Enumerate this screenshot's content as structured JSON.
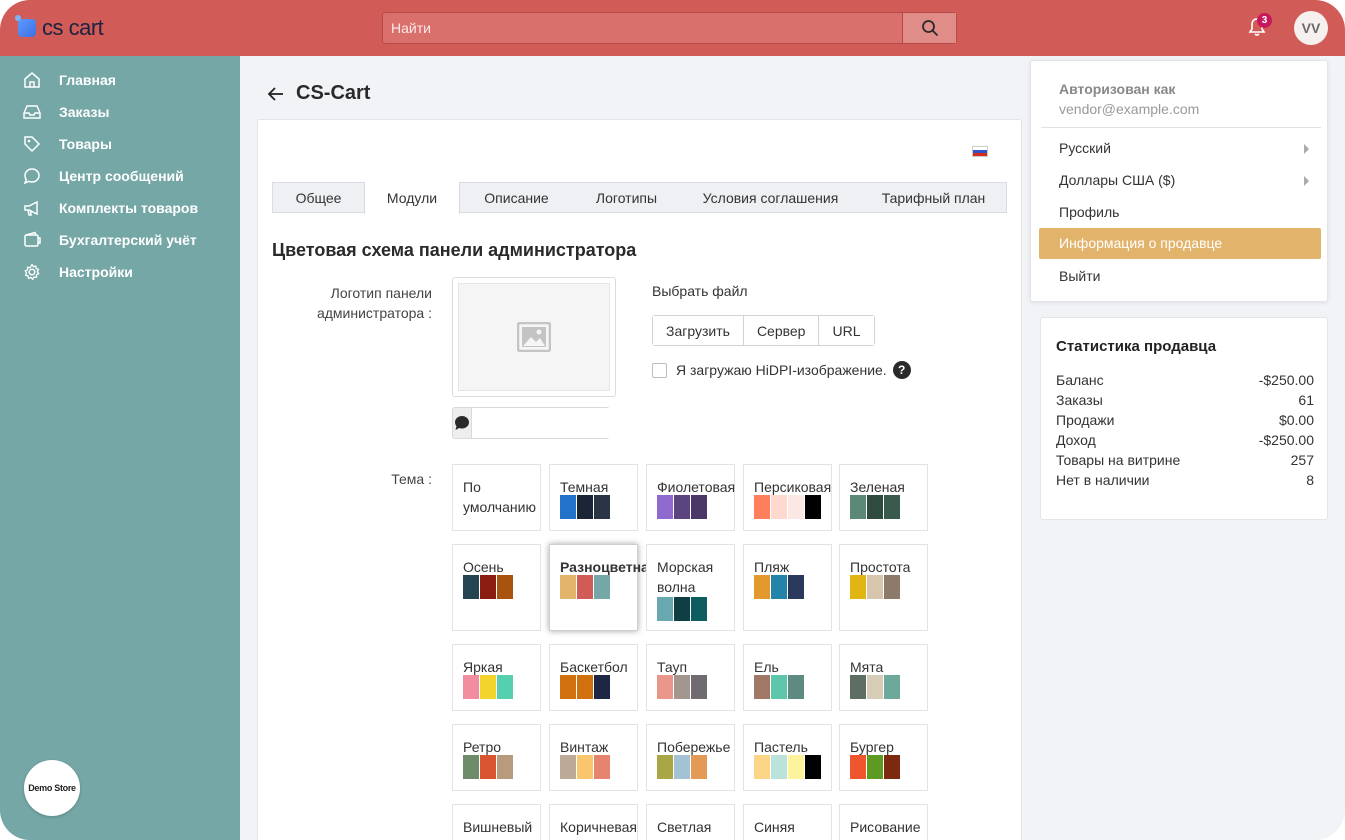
{
  "topbar": {
    "logo_text": "cs cart",
    "search_placeholder": "Найти",
    "notification_count": "3",
    "avatar_initials": "VV",
    "bar_color": "#d15b57"
  },
  "sidebar": {
    "color": "#75a7a6",
    "items": [
      {
        "label": "Главная",
        "icon": "home-icon"
      },
      {
        "label": "Заказы",
        "icon": "inbox-icon"
      },
      {
        "label": "Товары",
        "icon": "tag-icon"
      },
      {
        "label": "Центр сообщений",
        "icon": "chat-icon"
      },
      {
        "label": "Комплекты товаров",
        "icon": "megaphone-icon"
      },
      {
        "label": "Бухгалтерский учёт",
        "icon": "wallet-icon"
      },
      {
        "label": "Настройки",
        "icon": "gear-icon"
      }
    ],
    "demo_store_label": "Demo Store"
  },
  "page": {
    "title": "CS-Cart",
    "tabs": [
      {
        "label": "Общее",
        "active": false
      },
      {
        "label": "Модули",
        "active": true
      },
      {
        "label": "Описание",
        "active": false
      },
      {
        "label": "Логотипы",
        "active": false
      },
      {
        "label": "Условия соглашения",
        "active": false
      },
      {
        "label": "Тарифный план",
        "active": false
      }
    ],
    "section_title": "Цветовая схема панели администратора",
    "logo_label": "Логотип панели администратора :",
    "choose_file": "Выбрать файл",
    "upload_buttons": [
      "Загрузить",
      "Сервер",
      "URL"
    ],
    "hidpi_label": "Я загружаю HiDPI-изображение.",
    "help_symbol": "?",
    "theme_label": "Тема :",
    "themes": [
      {
        "name": "По умолчанию",
        "colors": []
      },
      {
        "name": "Темная",
        "colors": [
          "#2272c9",
          "#1c2536",
          "#2a3444"
        ]
      },
      {
        "name": "Фиолетовая",
        "colors": [
          "#8f6bd0",
          "#5c4480",
          "#4c3769"
        ]
      },
      {
        "name": "Персиковая",
        "colors": [
          "#ff7f5d",
          "#ffd8cf",
          "#fbe7e3",
          "#000000"
        ]
      },
      {
        "name": "Зеленая",
        "colors": [
          "#5a8a77",
          "#2f4b40",
          "#3a5a4e"
        ]
      },
      {
        "name": "Осень",
        "colors": [
          "#234450",
          "#8a1c12",
          "#a8540f"
        ]
      },
      {
        "name": "Разноцветная",
        "colors": [
          "#e2b36b",
          "#d15b57",
          "#75a7a6"
        ],
        "selected": true
      },
      {
        "name": "Морская волна",
        "colors": [
          "#6aa8b0",
          "#0f3f44",
          "#0c5c60"
        ]
      },
      {
        "name": "Пляж",
        "colors": [
          "#e39a2c",
          "#2383a8",
          "#293a5c"
        ]
      },
      {
        "name": "Простота",
        "colors": [
          "#e2b612",
          "#d7c5ad",
          "#8d7a68"
        ]
      },
      {
        "name": "Яркая",
        "colors": [
          "#f28da0",
          "#f3d42d",
          "#56cfb0"
        ]
      },
      {
        "name": "Баскетбол",
        "colors": [
          "#d1700f",
          "#d1700f",
          "#1d2643"
        ]
      },
      {
        "name": "Тауп",
        "colors": [
          "#e9978b",
          "#a39590",
          "#6f6b70"
        ]
      },
      {
        "name": "Ель",
        "colors": [
          "#a07866",
          "#5ec7ab",
          "#5f8a82"
        ]
      },
      {
        "name": "Мята",
        "colors": [
          "#5f6e62",
          "#d7cdb6",
          "#6ea89b"
        ]
      },
      {
        "name": "Ретро",
        "colors": [
          "#6e8c6a",
          "#d95532",
          "#b89a7d"
        ]
      },
      {
        "name": "Винтаж",
        "colors": [
          "#bda998",
          "#f9c56d",
          "#e6856f"
        ]
      },
      {
        "name": "Побережье",
        "colors": [
          "#a8a645",
          "#a3c3d4",
          "#e39a55"
        ]
      },
      {
        "name": "Пастель",
        "colors": [
          "#fcd586",
          "#bce2dc",
          "#fdf39b",
          "#000000"
        ]
      },
      {
        "name": "Бургер",
        "colors": [
          "#ef5630",
          "#5e9a21",
          "#7c2a0f"
        ]
      },
      {
        "name": "Вишневый",
        "colors": []
      },
      {
        "name": "Коричневая",
        "colors": []
      },
      {
        "name": "Светлая",
        "colors": []
      },
      {
        "name": "Синяя",
        "colors": []
      },
      {
        "name": "Рисование",
        "colors": []
      }
    ]
  },
  "account_menu": {
    "heading": "Авторизован как",
    "email": "vendor@example.com",
    "items": [
      {
        "label": "Русский",
        "submenu": true
      },
      {
        "label": "Доллары США  ($)",
        "submenu": true
      },
      {
        "label": "Профиль",
        "submenu": false
      },
      {
        "label": "Информация о продавце",
        "submenu": false,
        "active": true
      },
      {
        "label": "Выйти",
        "submenu": false
      }
    ],
    "active_color": "#e2b36b"
  },
  "vendor_stats": {
    "title": "Статистика продавца",
    "rows": [
      {
        "label": "Баланс",
        "value": "-$250.00"
      },
      {
        "label": "Заказы",
        "value": "61"
      },
      {
        "label": "Продажи",
        "value": "$0.00"
      },
      {
        "label": "Доход",
        "value": "-$250.00"
      },
      {
        "label": "Товары на витрине",
        "value": "257"
      },
      {
        "label": "Нет в наличии",
        "value": "8"
      }
    ]
  }
}
